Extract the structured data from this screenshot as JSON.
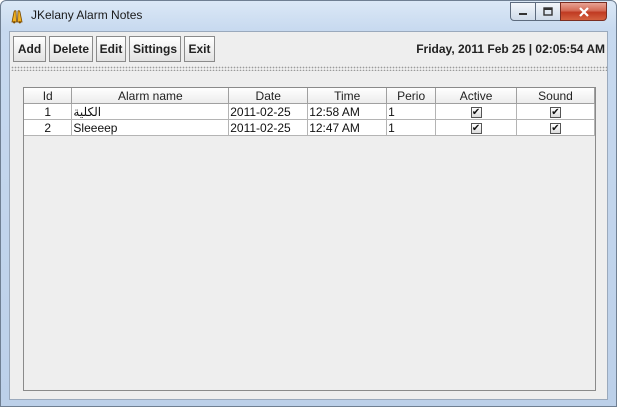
{
  "window": {
    "title": "JKelany Alarm Notes"
  },
  "toolbar": {
    "add_label": "Add",
    "delete_label": "Delete",
    "edit_label": "Edit",
    "settings_label": "Sittings",
    "exit_label": "Exit"
  },
  "datetime": "Friday, 2011 Feb 25  |  02:05:54 AM",
  "table": {
    "columns": [
      "Id",
      "Alarm name",
      "Date",
      "Time",
      "Perio",
      "Active",
      "Sound"
    ],
    "rows": [
      {
        "id": "1",
        "name": "الكلية",
        "date": "2011-02-25",
        "time": "12:58 AM",
        "period": "1",
        "active": true,
        "sound": true
      },
      {
        "id": "2",
        "name": "Sleeeep",
        "date": "2011-02-25",
        "time": "12:47 AM",
        "period": "1",
        "active": true,
        "sound": true
      }
    ]
  },
  "icons": {
    "app": "alarm-bells-icon",
    "check": "✔"
  }
}
